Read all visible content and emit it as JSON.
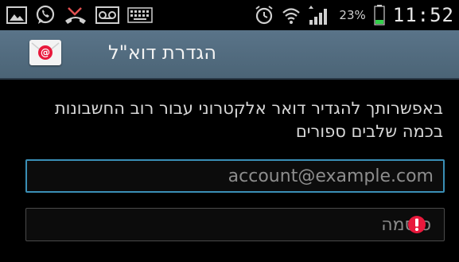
{
  "status_bar": {
    "left_icons": [
      "gallery-icon",
      "whatsapp-icon",
      "missed-call-icon",
      "voicemail-icon",
      "keyboard-icon"
    ],
    "right_icons": [
      "alarm-icon",
      "wifi-icon",
      "signal-icon",
      "battery-icon"
    ],
    "battery_percent": "23%",
    "time": "11:52"
  },
  "action_bar": {
    "app_icon": "email-app-icon",
    "title": "הגדרת דוא\"ל"
  },
  "setup": {
    "instruction": "באפשרותך להגדיר דואר אלקטרוני עבור רוב החשבונות בכמה שלבים ספורים",
    "email_placeholder": "account@example.com",
    "email_value": "",
    "password_placeholder": "סיסמה",
    "password_value": "",
    "password_error_icon": "error-icon"
  },
  "colors": {
    "action_bar": "#5a7489",
    "field_focus_border": "#3a8fb6",
    "error": "#e8193c",
    "battery": "#33d14a"
  }
}
